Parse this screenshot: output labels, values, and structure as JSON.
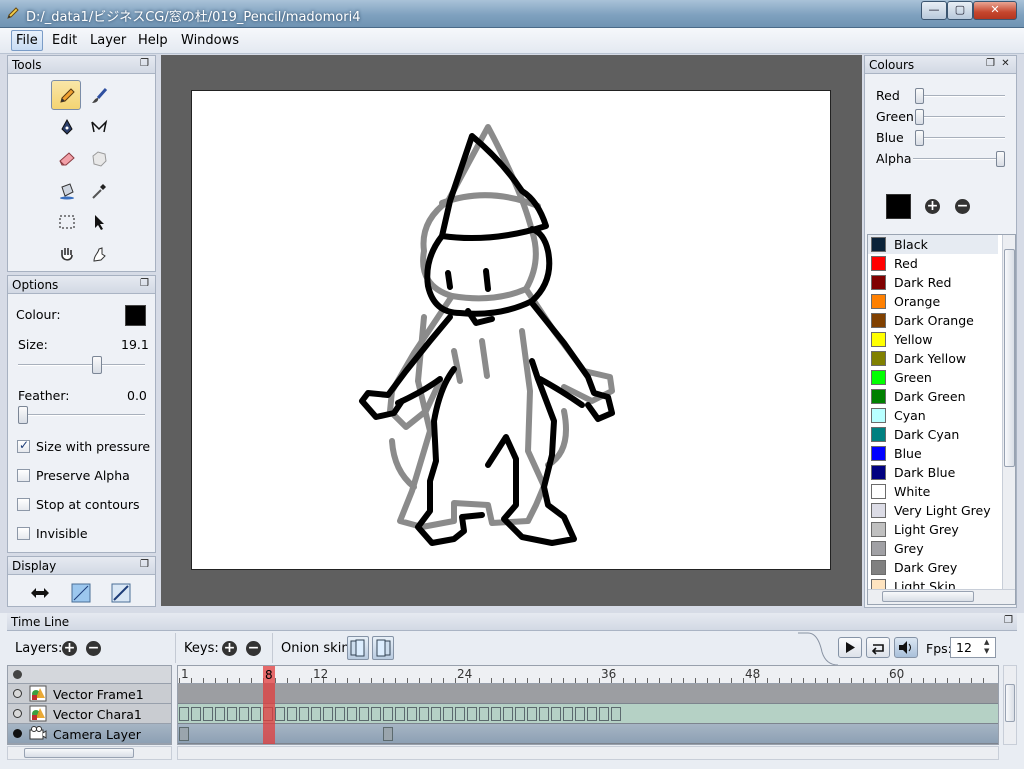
{
  "window": {
    "title": "D:/_data1/ビジネスCG/窓の杜/019_Pencil/madomori4"
  },
  "menu": {
    "file": "File",
    "edit": "Edit",
    "layer": "Layer",
    "help": "Help",
    "windows": "Windows"
  },
  "panels": {
    "tools": "Tools",
    "options": "Options",
    "display": "Display",
    "colours": "Colours",
    "timeline": "Time Line"
  },
  "options": {
    "colour_label": "Colour:",
    "colour_value": "#000000",
    "size_label": "Size:",
    "size_value": "19.1",
    "size_fraction": 0.63,
    "feather_label": "Feather:",
    "feather_value": "0.0",
    "feather_fraction": 0.0,
    "checkboxes": [
      {
        "label": "Size with pressure",
        "checked": true
      },
      {
        "label": "Preserve Alpha",
        "checked": false
      },
      {
        "label": "Stop at contours",
        "checked": false
      },
      {
        "label": "Invisible",
        "checked": false
      }
    ]
  },
  "colours": {
    "sliders": [
      {
        "label": "Red",
        "fraction": 0.0
      },
      {
        "label": "Green",
        "fraction": 0.0
      },
      {
        "label": "Blue",
        "fraction": 0.0
      },
      {
        "label": "Alpha",
        "fraction": 1.0
      }
    ],
    "current": "#000000",
    "swatches": [
      {
        "name": "Black",
        "color": "#0a2238",
        "selected": true
      },
      {
        "name": "Red",
        "color": "#ff0000"
      },
      {
        "name": "Dark Red",
        "color": "#800000"
      },
      {
        "name": "Orange",
        "color": "#ff8000"
      },
      {
        "name": "Dark Orange",
        "color": "#804000"
      },
      {
        "name": "Yellow",
        "color": "#ffff00"
      },
      {
        "name": "Dark Yellow",
        "color": "#808000"
      },
      {
        "name": "Green",
        "color": "#00ff00"
      },
      {
        "name": "Dark Green",
        "color": "#008000"
      },
      {
        "name": "Cyan",
        "color": "#b8ffff"
      },
      {
        "name": "Dark Cyan",
        "color": "#008080"
      },
      {
        "name": "Blue",
        "color": "#0000ff"
      },
      {
        "name": "Dark Blue",
        "color": "#000080"
      },
      {
        "name": "White",
        "color": "#ffffff"
      },
      {
        "name": "Very Light Grey",
        "color": "#dcdce6"
      },
      {
        "name": "Light Grey",
        "color": "#c0c0c0"
      },
      {
        "name": "Grey",
        "color": "#a0a0a4"
      },
      {
        "name": "Dark Grey",
        "color": "#808080"
      },
      {
        "name": "Light Skin",
        "color": "#ffe4c0"
      }
    ]
  },
  "timeline": {
    "layers_label": "Layers:",
    "keys_label": "Keys:",
    "onion_label": "Onion skin:",
    "fps_label": "Fps:",
    "fps_value": "12",
    "current_frame": "8",
    "ruler_labels": [
      "1",
      "12",
      "24",
      "36",
      "48",
      "60"
    ],
    "layers": [
      {
        "name": "Vector Frame1",
        "type": "vector",
        "keyframes": 0
      },
      {
        "name": "Vector Chara1",
        "type": "vector",
        "keyframes": 37
      },
      {
        "name": "Camera Layer",
        "type": "camera",
        "keyframes": 2
      }
    ]
  }
}
